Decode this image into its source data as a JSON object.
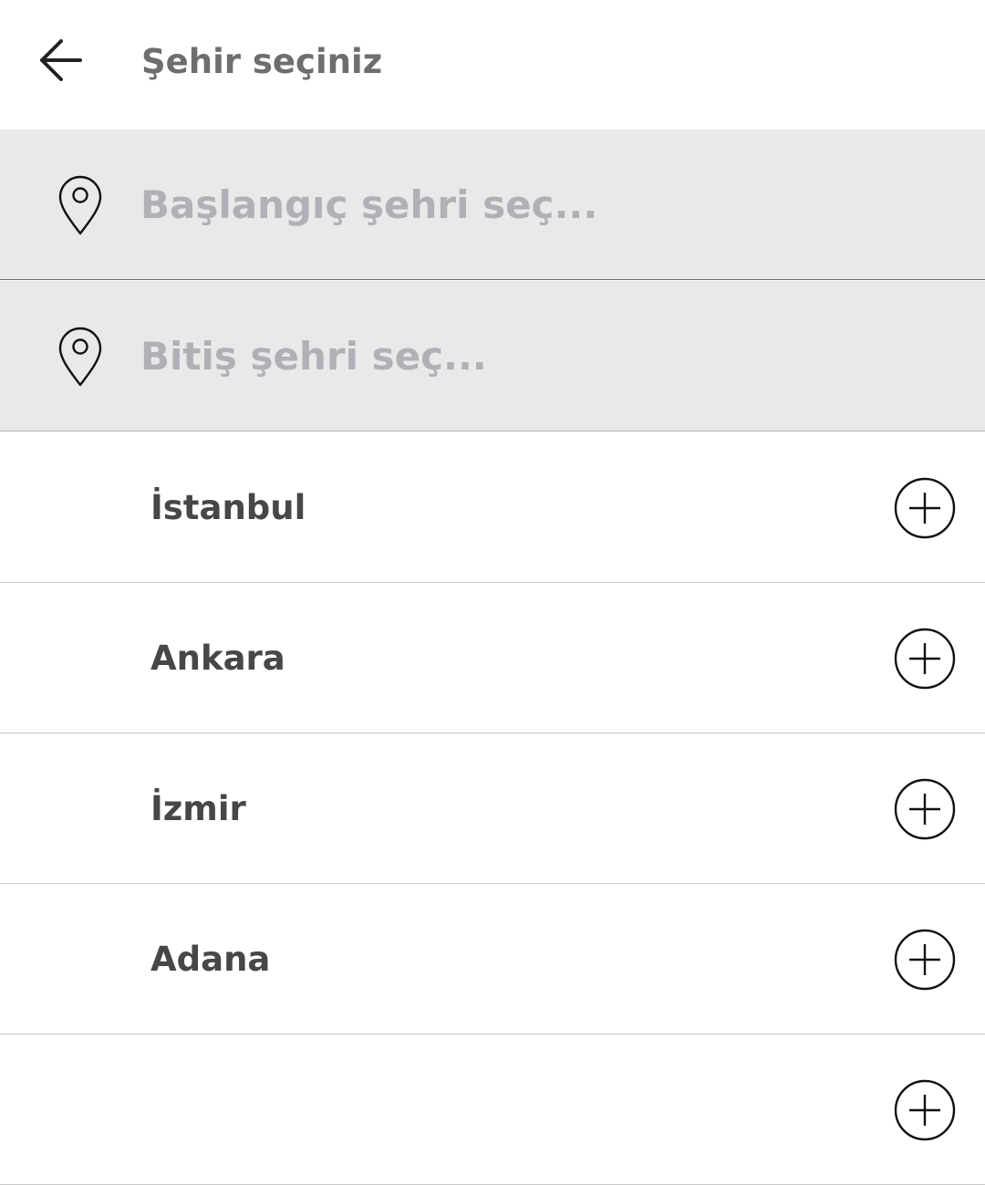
{
  "header": {
    "back_icon": "arrow-left-icon",
    "title": "Şehir seçiniz"
  },
  "search": {
    "start": {
      "icon": "map-pin-icon",
      "placeholder": "Başlangıç şehri seç...",
      "value": ""
    },
    "end": {
      "icon": "map-pin-icon",
      "placeholder": "Bitiş şehri seç...",
      "value": ""
    }
  },
  "cities": [
    {
      "name": "İstanbul",
      "action_icon": "add-circle-icon"
    },
    {
      "name": "Ankara",
      "action_icon": "add-circle-icon"
    },
    {
      "name": "İzmir",
      "action_icon": "add-circle-icon"
    },
    {
      "name": "Adana",
      "action_icon": "add-circle-icon"
    },
    {
      "name": "",
      "action_icon": "add-circle-icon"
    }
  ],
  "colors": {
    "title_text": "#6e6e6e",
    "field_background": "#e9e9e9",
    "placeholder_text": "#b0b0b6",
    "city_text": "#474747",
    "divider": "#c8c8c8"
  }
}
